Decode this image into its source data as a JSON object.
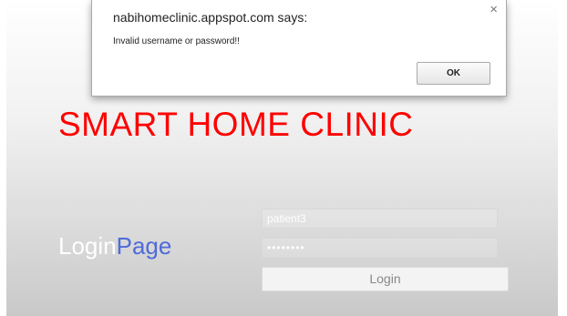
{
  "dialog": {
    "title": "nabihomeclinic.appspot.com says:",
    "close_glyph": "×",
    "message": "Invalid username or password!!",
    "ok_label": "OK"
  },
  "header": {
    "title": "SMART HOME CLINIC"
  },
  "login": {
    "heading_part1": "Login",
    "heading_part2": "Page",
    "username_value": "patient3",
    "password_value": "••••••••",
    "button_label": "Login"
  },
  "colors": {
    "title": "#ff0000",
    "heading_accent": "#4f6bd9"
  }
}
